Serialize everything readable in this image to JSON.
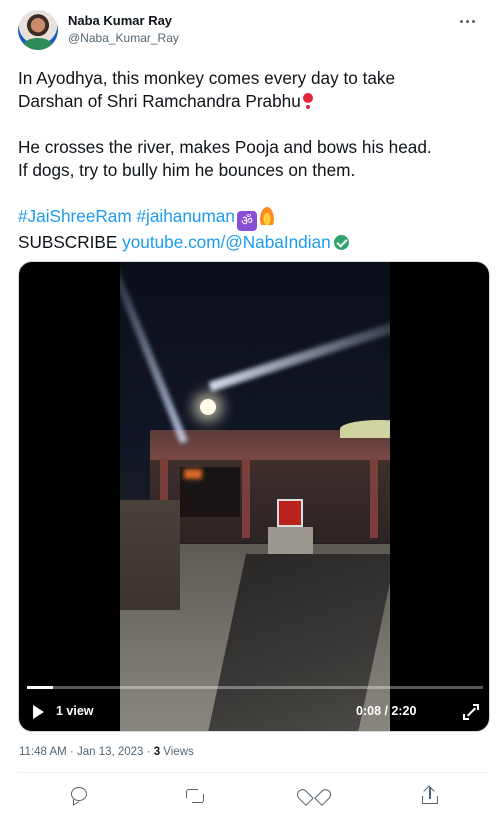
{
  "author": {
    "name": "Naba Kumar Ray",
    "handle": "@Naba_Kumar_Ray"
  },
  "tweet": {
    "line1a": "In Ayodhya, this monkey comes every day to take",
    "line1b": "Darshan of Shri Ramchandra Prabhu",
    "line2a": "He crosses the river, makes Pooja and bows his head.",
    "line2b": "If dogs, try to bully him he bounces on them.",
    "hashtag1": "#JaiShreeRam",
    "hashtag2": "#jaihanuman",
    "subscribe_label": "SUBSCRIBE",
    "subscribe_link": "youtube.com/@NabaIndian"
  },
  "video": {
    "views_label": "1 view",
    "time_label": "0:08 / 2:20",
    "progress": 0.057
  },
  "meta": {
    "timestamp": "11:48 AM · Jan 13, 2023 · ",
    "views_count": "3",
    "views_label": " Views"
  },
  "icons": {
    "more": "more-dots-icon",
    "verified": "verified-check-icon",
    "play": "play-icon",
    "fullscreen": "fullscreen-icon",
    "reply": "reply-icon",
    "retweet": "retweet-icon",
    "like": "like-icon",
    "share": "share-icon"
  },
  "colors": {
    "link": "#1d9bf0",
    "secondary": "#536471",
    "verified": "#2fa36b"
  }
}
